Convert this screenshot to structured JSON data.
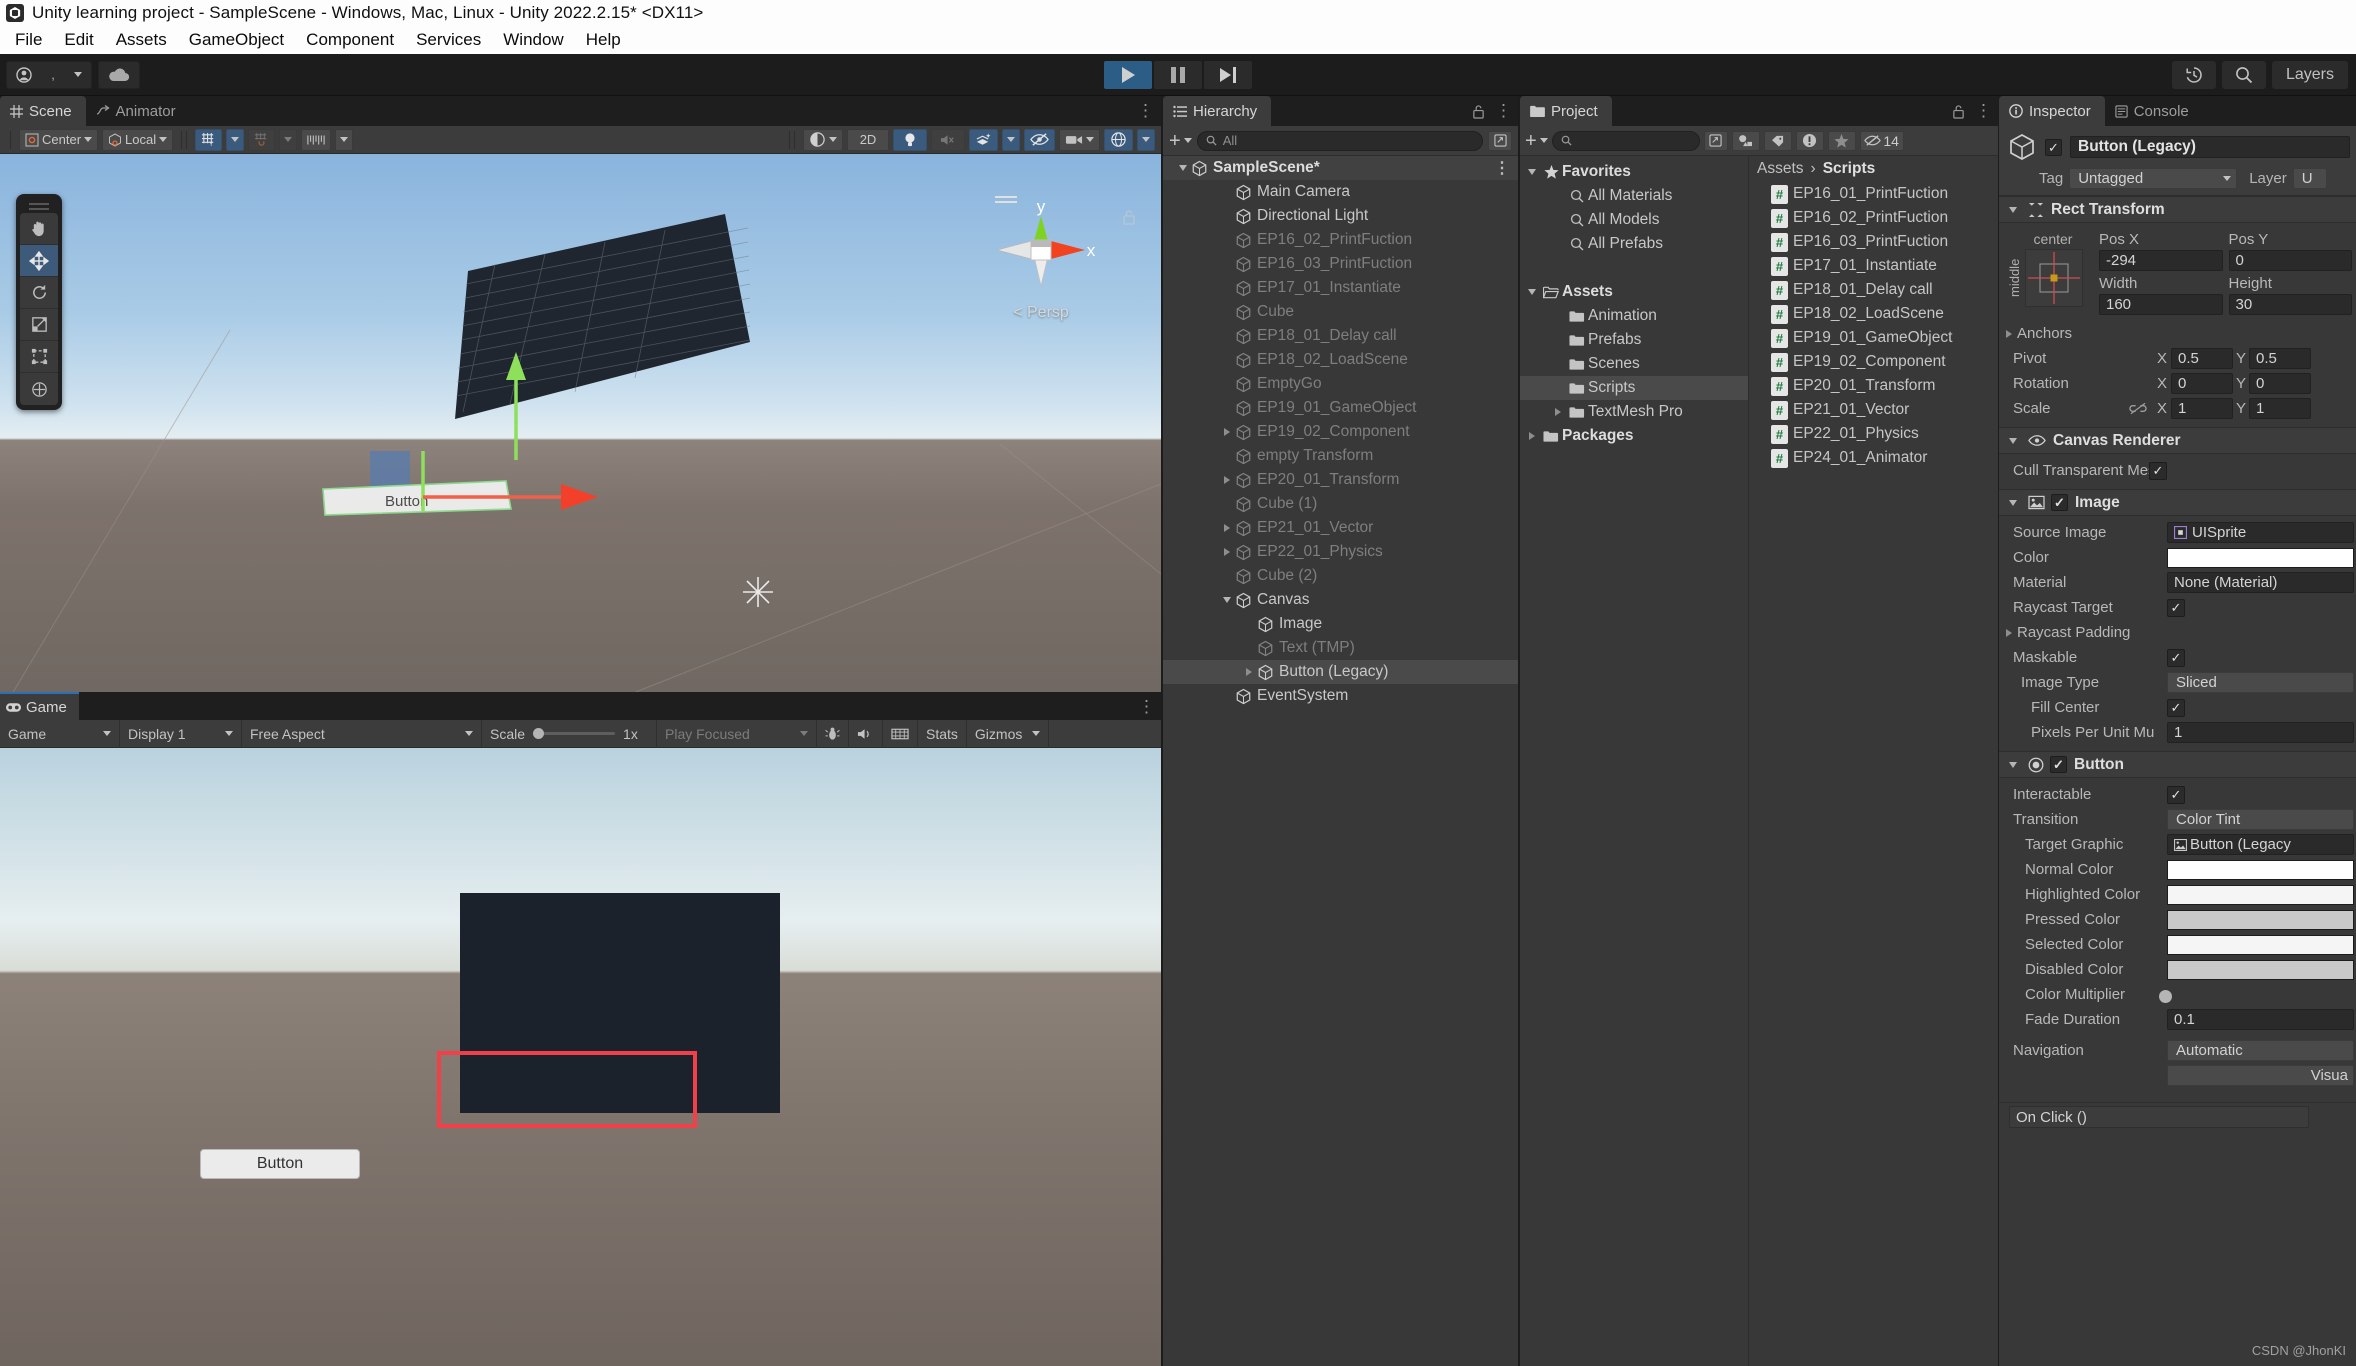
{
  "window": {
    "title": "Unity learning project - SampleScene - Windows, Mac, Linux - Unity 2022.2.15* <DX11>"
  },
  "menubar": {
    "items": [
      "File",
      "Edit",
      "Assets",
      "GameObject",
      "Component",
      "Services",
      "Window",
      "Help"
    ]
  },
  "toolbar": {
    "account_label": ",",
    "cloud_icon": "cloud-icon",
    "play_icon": "play-icon",
    "pause_icon": "pause-icon",
    "step_icon": "step-icon",
    "history_icon": "history-icon",
    "search_icon": "search-icon",
    "layers_label": "Layers"
  },
  "scene": {
    "tabs": [
      {
        "label": "Scene",
        "icon": "grid-icon",
        "active": true
      },
      {
        "label": "Animator",
        "icon": "animator-icon",
        "active": false
      }
    ],
    "toolbar": {
      "pivot_mode": "Center",
      "pivot_rotation": "Local",
      "grid_toggle": "grid-y-icon",
      "snap_icon": "snap-icon",
      "ruler_icon": "ruler-icon",
      "shading_icon": "shading-mode-icon",
      "mode_2d": "2D",
      "lighting_icon": "lightbulb-icon",
      "audio_icon": "audio-mute-icon",
      "fx_icon": "effects-icon",
      "hidden_icon": "hidden-objects-icon",
      "camera_icon": "scene-camera-icon",
      "gizmos_icon": "gizmos-icon"
    },
    "tools": [
      "hand-tool",
      "move-tool",
      "rotate-tool",
      "scale-tool",
      "rect-tool",
      "transform-tool"
    ],
    "active_tool_index": 1,
    "gizmo": {
      "y_label": "y",
      "x_label": "x",
      "perspective": "< Persp"
    },
    "object_label": "Button"
  },
  "game": {
    "tab_label": "Game",
    "toolbar": {
      "display_target": "Game",
      "display": "Display 1",
      "aspect": "Free Aspect",
      "scale_label": "Scale",
      "scale_value": "1x",
      "play_focused": "Play Focused",
      "mute_icon": "mute-audio-icon",
      "bug_icon": "bug-icon",
      "stats_label": "Stats",
      "gizmos_label": "Gizmos"
    },
    "button_label": "Button"
  },
  "hierarchy": {
    "tab_label": "Hierarchy",
    "add_label": "+",
    "search_placeholder": "All",
    "items": [
      {
        "label": "SampleScene*",
        "depth": 0,
        "arrow": "open",
        "root": true,
        "dim": false
      },
      {
        "label": "Main Camera",
        "depth": 2,
        "arrow": "none",
        "dim": false
      },
      {
        "label": "Directional Light",
        "depth": 2,
        "arrow": "none",
        "dim": false
      },
      {
        "label": "EP16_02_PrintFuction",
        "depth": 2,
        "arrow": "none",
        "dim": true
      },
      {
        "label": "EP16_03_PrintFuction",
        "depth": 2,
        "arrow": "none",
        "dim": true
      },
      {
        "label": "EP17_01_Instantiate",
        "depth": 2,
        "arrow": "none",
        "dim": true
      },
      {
        "label": "Cube",
        "depth": 2,
        "arrow": "none",
        "dim": true
      },
      {
        "label": "EP18_01_Delay call",
        "depth": 2,
        "arrow": "none",
        "dim": true
      },
      {
        "label": "EP18_02_LoadScene",
        "depth": 2,
        "arrow": "none",
        "dim": true
      },
      {
        "label": "EmptyGo",
        "depth": 2,
        "arrow": "none",
        "dim": true
      },
      {
        "label": "EP19_01_GameObject",
        "depth": 2,
        "arrow": "none",
        "dim": true
      },
      {
        "label": "EP19_02_Component",
        "depth": 2,
        "arrow": "closed",
        "dim": true
      },
      {
        "label": "empty Transform",
        "depth": 2,
        "arrow": "none",
        "dim": true
      },
      {
        "label": "EP20_01_Transform",
        "depth": 2,
        "arrow": "closed",
        "dim": true
      },
      {
        "label": "Cube (1)",
        "depth": 2,
        "arrow": "none",
        "dim": true
      },
      {
        "label": "EP21_01_Vector",
        "depth": 2,
        "arrow": "closed",
        "dim": true
      },
      {
        "label": "EP22_01_Physics",
        "depth": 2,
        "arrow": "closed",
        "dim": true
      },
      {
        "label": "Cube (2)",
        "depth": 2,
        "arrow": "none",
        "dim": true
      },
      {
        "label": "Canvas",
        "depth": 2,
        "arrow": "open",
        "dim": false
      },
      {
        "label": "Image",
        "depth": 3,
        "arrow": "none",
        "dim": false
      },
      {
        "label": "Text (TMP)",
        "depth": 3,
        "arrow": "none",
        "dim": true
      },
      {
        "label": "Button (Legacy)",
        "depth": 3,
        "arrow": "closed",
        "dim": false,
        "selected": true
      },
      {
        "label": "EventSystem",
        "depth": 2,
        "arrow": "none",
        "dim": false
      }
    ]
  },
  "project": {
    "tab_label": "Project",
    "add_label": "+",
    "search_placeholder": "",
    "hidden_count": "14",
    "filter_icons": [
      "asset-type-icon",
      "label-icon",
      "warning-icon",
      "favorite-star-icon",
      "hidden-eye-icon"
    ],
    "tree": [
      {
        "label": "Favorites",
        "depth": 0,
        "arrow": "open",
        "icon": "star-icon",
        "bold": true
      },
      {
        "label": "All Materials",
        "depth": 1,
        "arrow": "none",
        "icon": "search-icon"
      },
      {
        "label": "All Models",
        "depth": 1,
        "arrow": "none",
        "icon": "search-icon"
      },
      {
        "label": "All Prefabs",
        "depth": 1,
        "arrow": "none",
        "icon": "search-icon"
      },
      {
        "label": "",
        "depth": 0,
        "arrow": "none",
        "icon": "spacer"
      },
      {
        "label": "Assets",
        "depth": 0,
        "arrow": "open",
        "icon": "folder-open-icon",
        "bold": true
      },
      {
        "label": "Animation",
        "depth": 1,
        "arrow": "none",
        "icon": "folder-icon"
      },
      {
        "label": "Prefabs",
        "depth": 1,
        "arrow": "none",
        "icon": "folder-icon"
      },
      {
        "label": "Scenes",
        "depth": 1,
        "arrow": "none",
        "icon": "folder-icon"
      },
      {
        "label": "Scripts",
        "depth": 1,
        "arrow": "none",
        "icon": "folder-icon",
        "selected": true
      },
      {
        "label": "TextMesh Pro",
        "depth": 1,
        "arrow": "closed",
        "icon": "folder-icon"
      },
      {
        "label": "Packages",
        "depth": 0,
        "arrow": "closed",
        "icon": "folder-icon",
        "bold": true
      }
    ],
    "breadcrumb": {
      "root": "Assets",
      "sep": "›",
      "current": "Scripts"
    },
    "assets": [
      "EP16_01_PrintFuction",
      "EP16_02_PrintFuction",
      "EP16_03_PrintFuction",
      "EP17_01_Instantiate",
      "EP18_01_Delay call",
      "EP18_02_LoadScene",
      "EP19_01_GameObject",
      "EP19_02_Component",
      "EP20_01_Transform",
      "EP21_01_Vector",
      "EP22_01_Physics",
      "EP24_01_Animator"
    ],
    "asset_icon_glyph": "#"
  },
  "inspector": {
    "tabs": [
      {
        "label": "Inspector",
        "icon": "info-icon",
        "active": true
      },
      {
        "label": "Console",
        "icon": "console-icon",
        "active": false
      }
    ],
    "object": {
      "enabled": true,
      "name": "Button (Legacy)",
      "tag_label": "Tag",
      "tag_value": "Untagged",
      "layer_label": "Layer",
      "layer_value": "U"
    },
    "rect_transform": {
      "title": "Rect Transform",
      "anchor_preset_h": "center",
      "anchor_preset_v": "middle",
      "pos_x_label": "Pos X",
      "pos_x": "-294",
      "pos_y_label": "Pos Y",
      "pos_y": "0",
      "width_label": "Width",
      "width": "160",
      "height_label": "Height",
      "height": "30",
      "anchors_label": "Anchors",
      "pivot_label": "Pivot",
      "pivot_x": "0.5",
      "pivot_y": "0.5",
      "rotation_label": "Rotation",
      "rot_x": "0",
      "rot_y": "0",
      "scale_label": "Scale",
      "scale_x": "1",
      "scale_y": "1",
      "axis_x": "X",
      "axis_y": "Y"
    },
    "canvas_renderer": {
      "title": "Canvas Renderer",
      "cull_label": "Cull Transparent Mes",
      "cull_checked": true
    },
    "image": {
      "title": "Image",
      "enabled": true,
      "source_image_label": "Source Image",
      "source_image_value": "UISprite",
      "color_label": "Color",
      "color_value": "#FFFFFF",
      "material_label": "Material",
      "material_value": "None (Material)",
      "raycast_target_label": "Raycast Target",
      "raycast_target_checked": true,
      "raycast_padding_label": "Raycast Padding",
      "maskable_label": "Maskable",
      "maskable_checked": true,
      "image_type_label": "Image Type",
      "image_type_value": "Sliced",
      "fill_center_label": "Fill Center",
      "fill_center_checked": true,
      "ppu_label": "Pixels Per Unit Mu",
      "ppu_value": "1"
    },
    "button": {
      "title": "Button",
      "enabled": true,
      "interactable_label": "Interactable",
      "interactable_checked": true,
      "transition_label": "Transition",
      "transition_value": "Color Tint",
      "target_graphic_label": "Target Graphic",
      "target_graphic_value": "Button (Legacy",
      "normal_color_label": "Normal Color",
      "normal_color_value": "#FFFFFF",
      "highlighted_color_label": "Highlighted Color",
      "highlighted_color_value": "#F5F5F5",
      "pressed_color_label": "Pressed Color",
      "pressed_color_value": "#C8C8C8",
      "selected_color_label": "Selected Color",
      "selected_color_value": "#F5F5F5",
      "disabled_color_label": "Disabled Color",
      "disabled_color_value": "#C8C8C8",
      "color_multiplier_label": "Color Multiplier",
      "fade_duration_label": "Fade Duration",
      "fade_duration_value": "0.1",
      "navigation_label": "Navigation",
      "navigation_value": "Automatic",
      "visualize_label": "Visua",
      "onclick_label": "On Click ()"
    }
  },
  "watermark": "CSDN @JhonKI"
}
